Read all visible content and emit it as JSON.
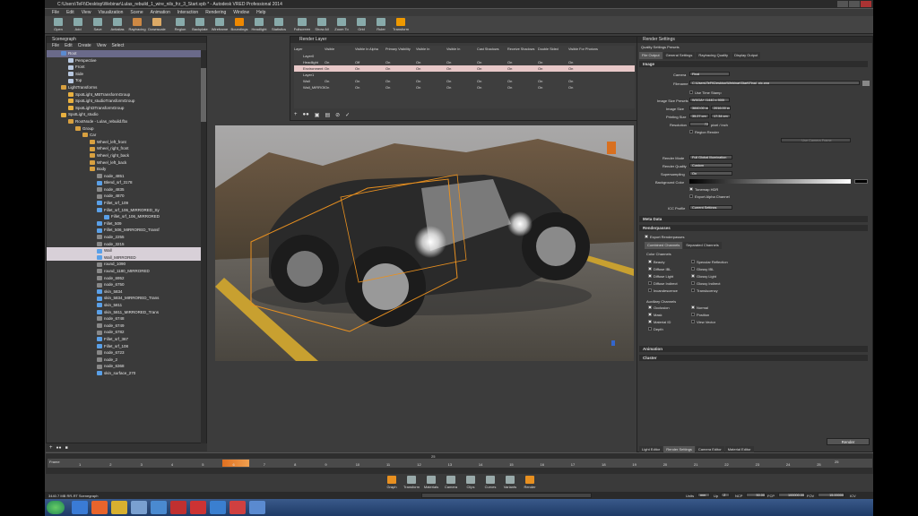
{
  "window": {
    "title": "C:\\Users\\TeFt\\Desktop\\Webinar\\Lulas_rebuild_1_wire_nils_frz_3_Start.vpb * - Autodesk VRED Professional 2014"
  },
  "menu": [
    "File",
    "Edit",
    "View",
    "Visualization",
    "Scene",
    "Animation",
    "Interaction",
    "Rendering",
    "Window",
    "Help"
  ],
  "toolbar": [
    "Open",
    "Add",
    "Save",
    "Antialias",
    "Raytracing",
    "Downscale",
    "Region",
    "Backplate",
    "Wireframe",
    "Boundings",
    "Headlight",
    "Statistics",
    "Fullscreen",
    "Show All",
    "Zoom To",
    "Grid",
    "Ruler",
    "Transform"
  ],
  "scenegraph": {
    "title": "Scenegraph",
    "menu": [
      "File",
      "Edit",
      "Create",
      "View",
      "Select"
    ],
    "rows": [
      {
        "label": "Root",
        "type": "root",
        "sel": true,
        "indent": 2
      },
      {
        "label": "Perspective",
        "type": "cam",
        "indent": 3
      },
      {
        "label": "Front",
        "type": "cam",
        "indent": 3
      },
      {
        "label": "Side",
        "type": "cam",
        "indent": 3
      },
      {
        "label": "Top",
        "type": "cam",
        "indent": 3
      },
      {
        "label": "LightTransforms",
        "type": "group",
        "indent": 2
      },
      {
        "label": "SpotLight_MBTransformGroup",
        "type": "light",
        "indent": 3
      },
      {
        "label": "SpotLight_studioTransformGroup",
        "type": "light",
        "indent": 3
      },
      {
        "label": "SpotLight3TransformGroup",
        "type": "light",
        "indent": 3
      },
      {
        "label": "SpotLight_studio",
        "type": "light",
        "indent": 2
      },
      {
        "label": "RootNode - Lulas_rebuild.fbx",
        "type": "group",
        "indent": 3
      },
      {
        "label": "Group",
        "type": "group",
        "indent": 4
      },
      {
        "label": "Car",
        "type": "group",
        "indent": 5
      },
      {
        "label": "Wheel_left_front",
        "type": "group",
        "indent": 6
      },
      {
        "label": "Wheel_right_front",
        "type": "group",
        "indent": 6
      },
      {
        "label": "Wheel_right_back",
        "type": "group",
        "indent": 6
      },
      {
        "label": "Wheel_left_back",
        "type": "group",
        "indent": 6
      },
      {
        "label": "Body",
        "type": "group",
        "indent": 6
      },
      {
        "label": "node_4851",
        "type": "mesh",
        "indent": 7
      },
      {
        "label": "Blend_srf_3178",
        "type": "surf",
        "indent": 7
      },
      {
        "label": "node_4835",
        "type": "mesh",
        "indent": 7
      },
      {
        "label": "node_4870",
        "type": "mesh",
        "indent": 7
      },
      {
        "label": "Fillet_srf_109",
        "type": "surf",
        "indent": 7
      },
      {
        "label": "Fillet_srf_106_MIRRORED_Sy",
        "type": "surf",
        "indent": 7
      },
      {
        "label": "Fillet_srf_106_MIRRORED",
        "type": "surf",
        "indent": 8
      },
      {
        "label": "Fillet_509",
        "type": "surf",
        "indent": 7
      },
      {
        "label": "Fillet_506_MIRRORED_Transf",
        "type": "surf",
        "indent": 7
      },
      {
        "label": "node_2255",
        "type": "mesh",
        "indent": 7
      },
      {
        "label": "node_3215",
        "type": "mesh",
        "indent": 7
      },
      {
        "label": "Wall",
        "type": "surf",
        "indent": 7,
        "hl": true
      },
      {
        "label": "Wall_MIRRORED",
        "type": "surf",
        "indent": 7,
        "hl": true
      },
      {
        "label": "round_1090",
        "type": "mesh",
        "indent": 7
      },
      {
        "label": "round_1180_MIRRORED",
        "type": "mesh",
        "indent": 7
      },
      {
        "label": "node_6952",
        "type": "mesh",
        "indent": 7
      },
      {
        "label": "node_6750",
        "type": "mesh",
        "indent": 7
      },
      {
        "label": "skin_5834",
        "type": "surf",
        "indent": 7
      },
      {
        "label": "skin_5834_MIRRORED_Trans",
        "type": "surf",
        "indent": 7
      },
      {
        "label": "skin_5811",
        "type": "surf",
        "indent": 7
      },
      {
        "label": "skin_5811_MIRRORED_Trans",
        "type": "surf",
        "indent": 7
      },
      {
        "label": "node_6748",
        "type": "mesh",
        "indent": 7
      },
      {
        "label": "node_6749",
        "type": "mesh",
        "indent": 7
      },
      {
        "label": "node_6782",
        "type": "mesh",
        "indent": 7
      },
      {
        "label": "Fillet_srf_367",
        "type": "surf",
        "indent": 7
      },
      {
        "label": "Fillet_srf_108",
        "type": "surf",
        "indent": 7
      },
      {
        "label": "node_6723",
        "type": "mesh",
        "indent": 7
      },
      {
        "label": "node_2",
        "type": "mesh",
        "indent": 7
      },
      {
        "label": "node_6368",
        "type": "mesh",
        "indent": 7
      },
      {
        "label": "skin_surface_270",
        "type": "surf",
        "indent": 7
      }
    ]
  },
  "renderlayer": {
    "title": "Render Layer",
    "headers": [
      "Layer",
      "Visible",
      "Visible In Alpha",
      "Primary Visibility",
      "Visible In Reflections",
      "Visible In Refractions",
      "Cast Shadows",
      "Receive Shadows",
      "Double Sided",
      "Visible For Photons"
    ],
    "rows": [
      {
        "cells": [
          "Layer0",
          "",
          "",
          "",
          "",
          "",
          "",
          "",
          "",
          ""
        ],
        "pink": false
      },
      {
        "cells": [
          "Headlight",
          "On",
          "Off",
          "On",
          "On",
          "On",
          "On",
          "On",
          "On",
          "On"
        ],
        "pink": false
      },
      {
        "cells": [
          "Environment",
          "On",
          "On",
          "On",
          "On",
          "On",
          "On",
          "On",
          "On",
          "On"
        ],
        "pink": true
      },
      {
        "cells": [
          "Layer1",
          "",
          "",
          "",
          "",
          "",
          "",
          "",
          "",
          ""
        ],
        "pink": false
      },
      {
        "cells": [
          "Wall",
          "On",
          "On",
          "On",
          "On",
          "On",
          "On",
          "On",
          "On",
          "On"
        ],
        "pink": false
      },
      {
        "cells": [
          "Wall_MIRRORED - Off",
          "On",
          "On",
          "On",
          "On",
          "On",
          "On",
          "On",
          "On",
          "On"
        ],
        "pink": false
      }
    ]
  },
  "rendersettings": {
    "title": "Render Settings",
    "presets": "Quality Settings Presets",
    "tabs": [
      "File Output",
      "General Settings",
      "Raytracing Quality",
      "Display Output"
    ],
    "image_section": "Image",
    "camera_label": "Camera",
    "camera_val": "Final",
    "filename_label": "Filename",
    "filename_val": "C:\\Users\\TeFt\\Desktop\\Webinar\\Start\\Final_pic.png",
    "timestamp": "Use Time Stamp",
    "sizepreset_label": "Image Size Presets",
    "sizepreset_val": "WXGA+ (1440 x 900)",
    "imagesize_label": "Image Size",
    "imagesize_w": "3840.00 px",
    "imagesize_h": "2016.00 px",
    "printsize_label": "Printing Size",
    "printsize_w": "35.27 cm",
    "printsize_h": "17.34 cm",
    "resolution_label": "Resolution",
    "resolution_val": "72",
    "resolution_unit": "pixel / inch",
    "region": "Region Render",
    "use_camera": "Use Camera Frame",
    "rendermode_label": "Render Mode",
    "rendermode_val": "Full Global Illumination",
    "quality_label": "Render Quality",
    "quality_val": "Custom",
    "super_label": "Supersampling",
    "super_val": "On",
    "bg_label": "Background Color",
    "tonemap": "Tonemap HDR",
    "alpha": "Export Alpha Channel",
    "icc_label": "ICC Profile",
    "icc_val": "Current Settings",
    "meta": "Meta Data",
    "passes": "Renderpasses",
    "export_passes": "Export Renderpasses",
    "subtabs": [
      "Combined Channels",
      "Separated Channels"
    ],
    "color_channels": "Color Channels",
    "col_left": [
      "Beauty",
      "Diffuse IBL",
      "Diffuse Light",
      "Diffuse Indirect",
      "Incandescence"
    ],
    "col_right": [
      "Specular Reflection",
      "Glossy IBL",
      "Glossy Light",
      "Glossy Indirect",
      "Translucency"
    ],
    "aux_channels": "Auxiliary Channels",
    "aux_left": [
      "Occlusion",
      "Mask",
      "Material ID",
      "Depth"
    ],
    "aux_right": [
      "Normal",
      "Position",
      "View Vector"
    ],
    "animation": "Animation",
    "cluster": "Cluster",
    "bottom_tabs": [
      "Light Editor",
      "Render Settings",
      "Camera Editor",
      "Material Editor"
    ],
    "render_btn": "Render"
  },
  "timeline": {
    "label": "Frame",
    "end": "25",
    "ticks": [
      "1",
      "2",
      "3",
      "4",
      "5",
      "6",
      "7",
      "8",
      "9",
      "10",
      "11",
      "12",
      "13",
      "14",
      "15",
      "16",
      "17",
      "18",
      "19",
      "20",
      "21",
      "22",
      "23",
      "24",
      "25"
    ],
    "fps": "25"
  },
  "bottomtools": [
    "Graph",
    "Transform",
    "Materials",
    "Camera",
    "Clips",
    "Curves",
    "Variants",
    "Render"
  ],
  "status": {
    "left": "3440.7 MB  RR-RT  Scenegraph",
    "units": "Units",
    "units_val": "mm",
    "up": "Up",
    "up_val": "Z",
    "ncp": "NCP",
    "ncp_val": "50.00",
    "fcp": "FCP",
    "fcp_val": "100000.00",
    "fov": "FOV",
    "fov_val": "15.00000",
    "icv": "ICV"
  }
}
